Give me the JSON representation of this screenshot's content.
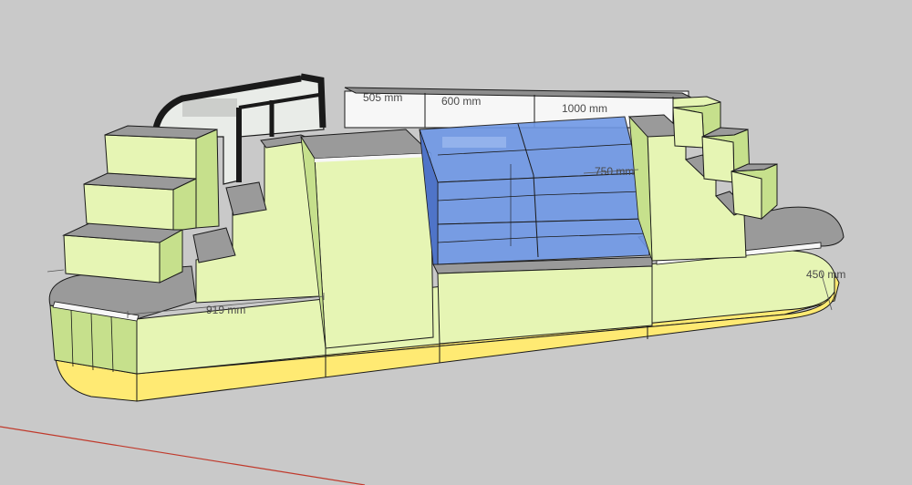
{
  "viewport": {
    "background": "#c9c9c9",
    "axis_color": "#c0392b"
  },
  "model": {
    "colors": {
      "panel": "#e6f5b4",
      "panel_side": "#c6e08c",
      "top": "#9a9a9a",
      "plinth": "#ffea73",
      "plinth_side": "#e8d258",
      "glass": "#6f98e6",
      "glass_dark": "#4f74c8",
      "frame": "#1a1a1a",
      "white_unit": "#f7f7f7"
    }
  },
  "dimensions": {
    "d1": "919 mm",
    "d2": "450 mm",
    "d3": "750 mm",
    "d4": "505 mm",
    "d5": "600 mm",
    "d6": "1000 mm"
  }
}
